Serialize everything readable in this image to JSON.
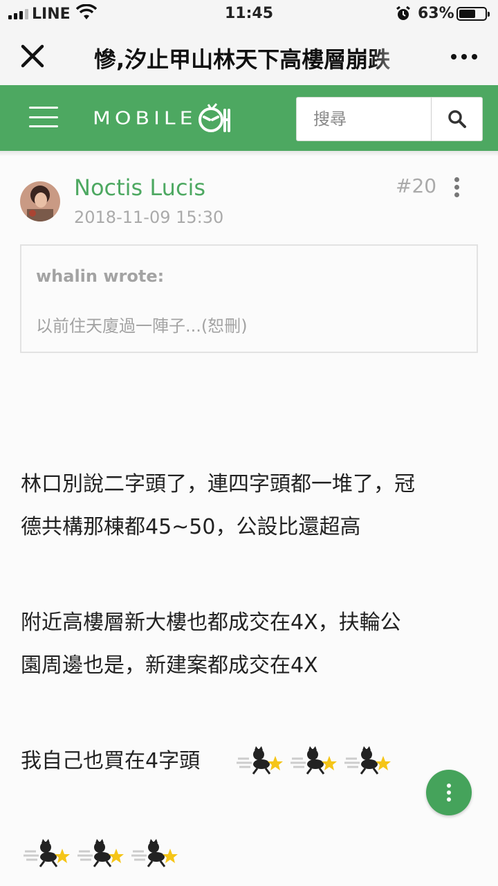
{
  "status_bar": {
    "carrier": "LINE",
    "time": "11:45",
    "battery_percent": "63%",
    "battery_level": 0.63
  },
  "title_bar": {
    "title": "慘,汐止甲山林天下高樓層崩跌"
  },
  "header": {
    "logo_text": "MOBILE",
    "search_placeholder": "搜尋",
    "brand_color": "#4da861"
  },
  "post": {
    "author": "Noctis Lucis",
    "date": "2018-11-09 15:30",
    "floor": "#20",
    "quote": {
      "who": "whalin wrote:",
      "text": "以前住天廈過一陣子...(恕刪)"
    },
    "lines": [
      "林口別說二字頭了，連四字頭都一堆了，冠",
      "德共構那棟都45~50，公設比還超高",
      "附近高樓層新大樓也都成交在4X，扶輪公",
      "園周邊也是，新建案都成交在4X",
      "我自己也買在4字頭"
    ],
    "emoji_names": [
      "running-cat-icon",
      "running-cat-icon",
      "running-cat-icon"
    ]
  }
}
